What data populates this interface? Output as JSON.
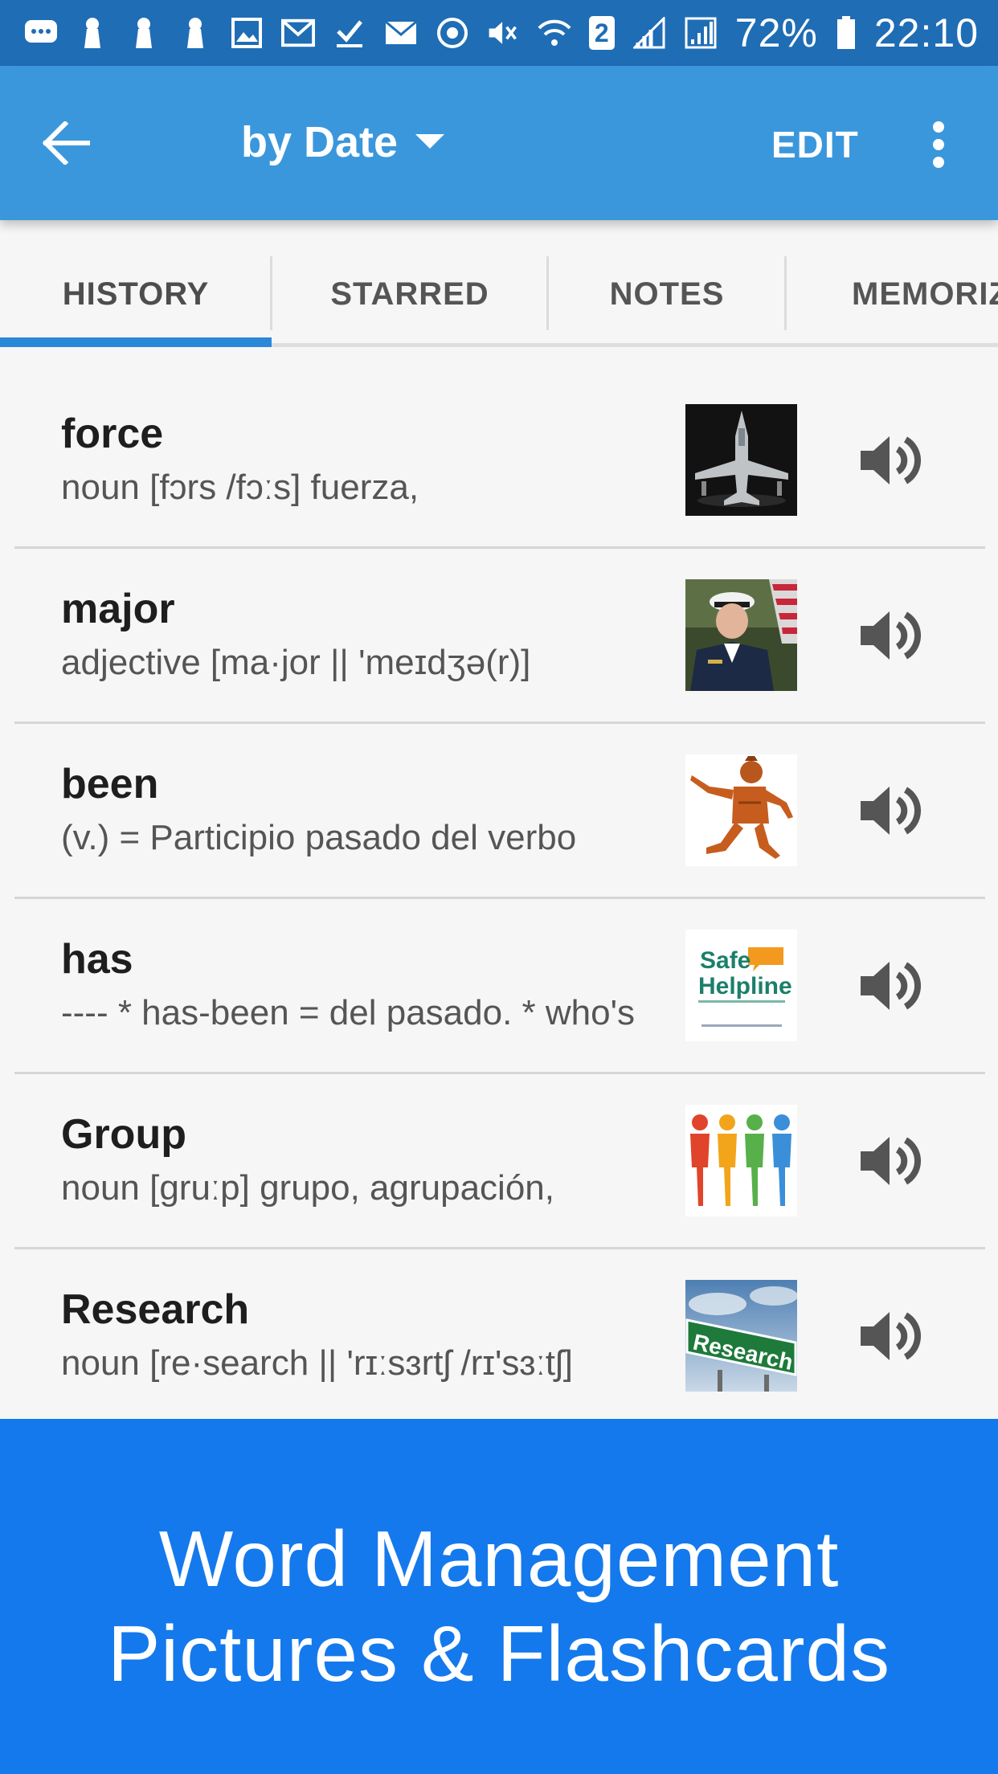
{
  "status_bar": {
    "battery_text": "72%",
    "time": "22:10",
    "sim_badge": "2"
  },
  "app_bar": {
    "sort_label": "by Date",
    "edit_label": "EDIT"
  },
  "tabs": [
    {
      "label": "HISTORY",
      "active": true
    },
    {
      "label": "STARRED",
      "active": false
    },
    {
      "label": "NOTES",
      "active": false
    },
    {
      "label": "MEMORIZ",
      "active": false
    }
  ],
  "entries": [
    {
      "word": "force",
      "definition": "noun [fɔrs /fɔːs] fuerza,",
      "image": "fighter-jet"
    },
    {
      "word": "major",
      "definition": "adjective [ma·jor || 'meɪdʒə(r)]",
      "image": "military-officer"
    },
    {
      "word": "been",
      "definition": "(v.) = Participio pasado del verbo",
      "image": "dancing-figure"
    },
    {
      "word": "has",
      "definition": "---- * has-been = del pasado. * who's",
      "image": "safe-helpline-logo"
    },
    {
      "word": "Group",
      "definition": "noun [gruːp] grupo, agrupación,",
      "image": "people-group"
    },
    {
      "word": "Research",
      "definition": "noun [re·search || 'rɪːsɜrtʃ /rɪ'sɜːtʃ]",
      "image": "research-sign"
    }
  ],
  "thumbnail_text": {
    "helpline_line1": "Safe",
    "helpline_line2": "Helpline",
    "research_sign": "Research"
  },
  "banner": {
    "line1": "Word Management",
    "line2": "Pictures & Flashcards"
  },
  "colors": {
    "status_bar": "#1f6db5",
    "app_bar": "#3b97dc",
    "tab_indicator": "#2b88d8",
    "banner": "#1479ec"
  }
}
